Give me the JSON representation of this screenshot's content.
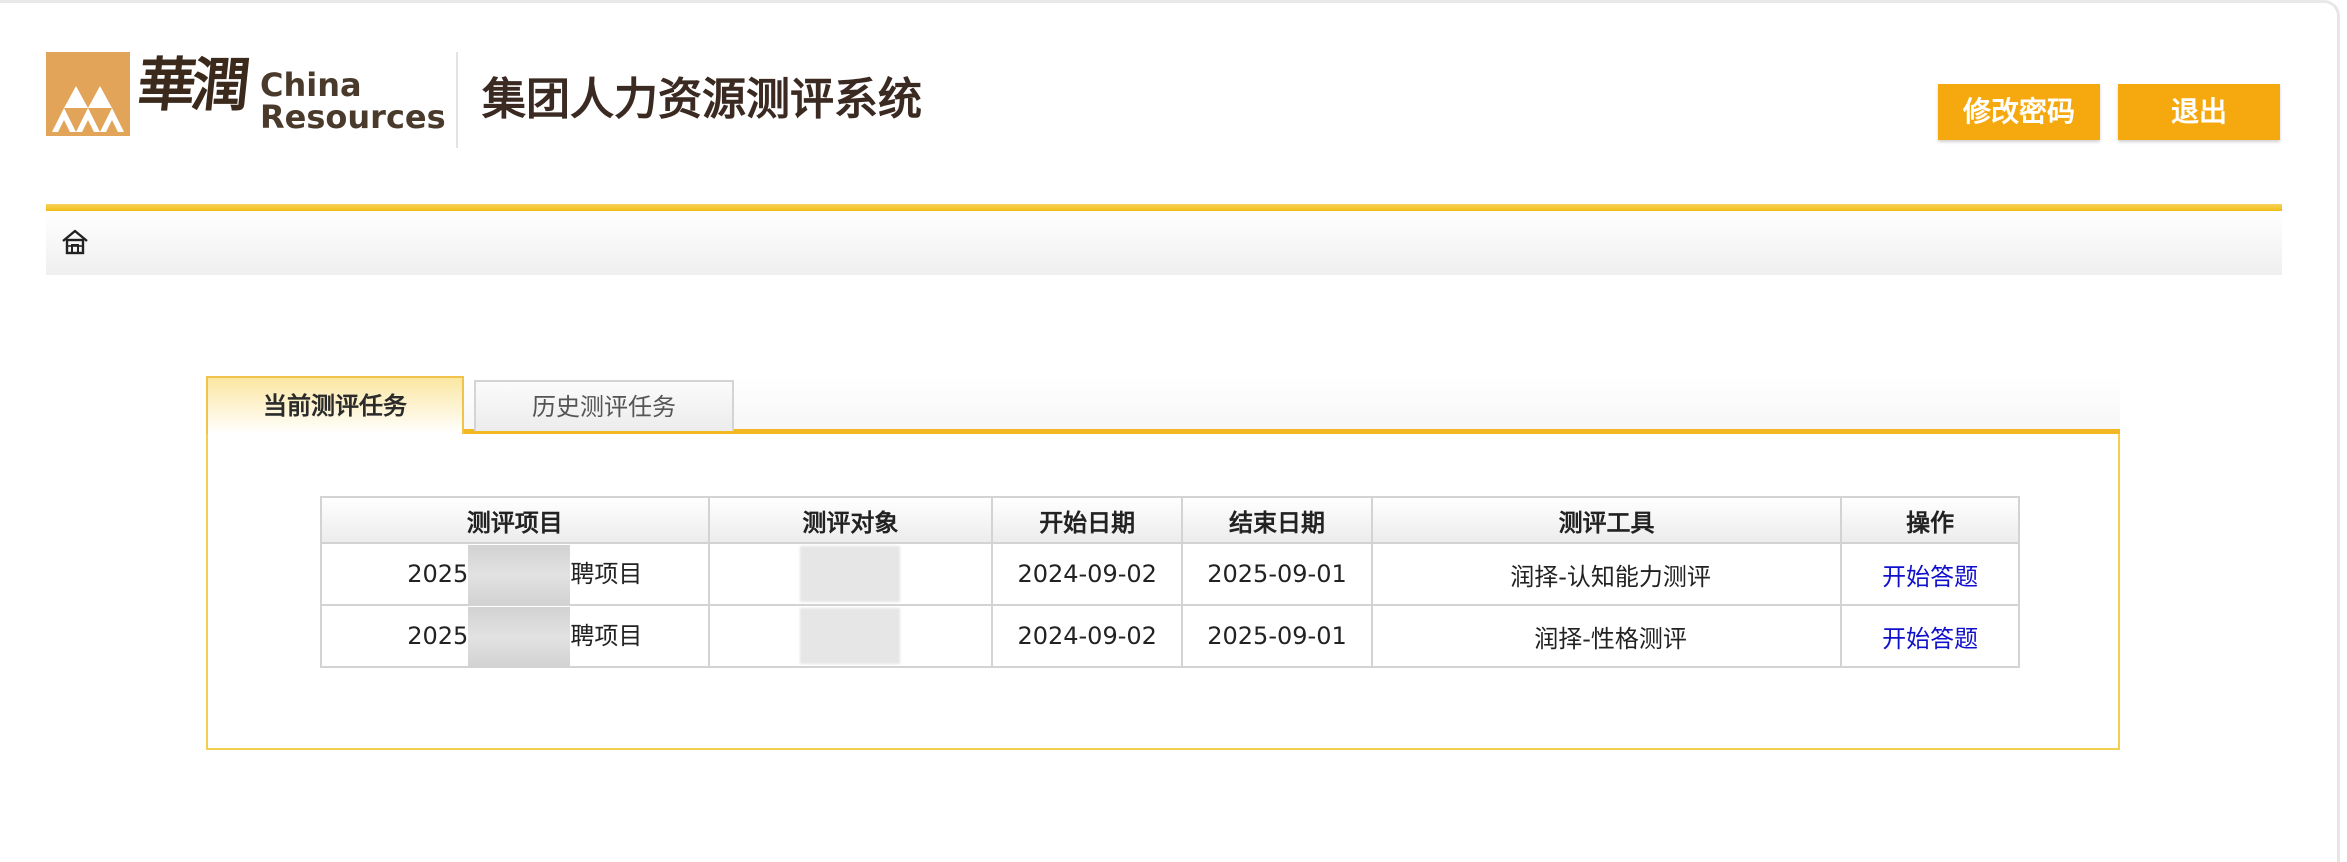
{
  "brand": {
    "logo_cn": "華潤",
    "logo_en_line1": "China",
    "logo_en_line2": "Resources",
    "brand_color": "#e2a458"
  },
  "header": {
    "title": "集团人力资源测评系统",
    "change_password_label": "修改密码",
    "logout_label": "退出",
    "accent_color": "#f5a90f"
  },
  "breadcrumb": {
    "icon": "home-icon"
  },
  "tabs": [
    {
      "label": "当前测评任务",
      "active": true
    },
    {
      "label": "历史测评任务",
      "active": false
    }
  ],
  "table": {
    "columns": [
      "测评项目",
      "测评对象",
      "开始日期",
      "结束日期",
      "测评工具",
      "操作"
    ],
    "rows": [
      {
        "project_prefix": "2025",
        "project_suffix": "聘项目",
        "target": "",
        "start": "2024-09-02",
        "end": "2025-09-01",
        "tool": "润择-认知能力测评",
        "action": "开始答题"
      },
      {
        "project_prefix": "2025",
        "project_suffix": "聘项目",
        "target": "",
        "start": "2024-09-02",
        "end": "2025-09-01",
        "tool": "润择-性格测评",
        "action": "开始答题"
      }
    ]
  }
}
